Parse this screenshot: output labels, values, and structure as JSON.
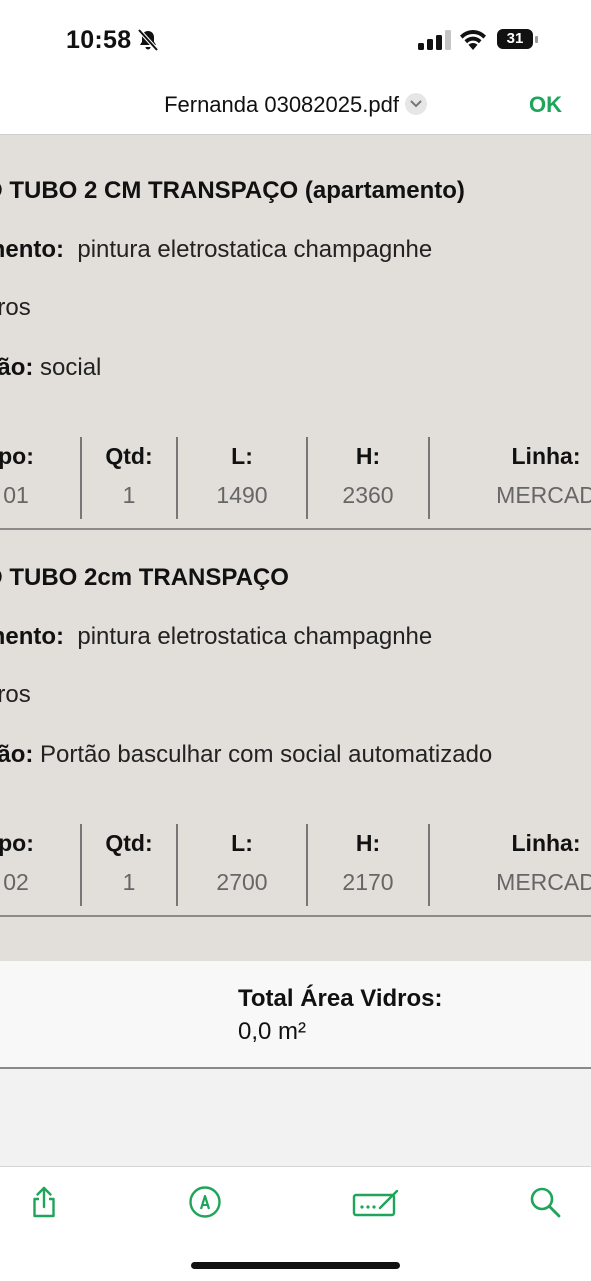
{
  "status": {
    "time": "10:58",
    "battery": "31"
  },
  "nav": {
    "title": "Fernanda 03082025.pdf",
    "ok_label": "OK"
  },
  "items": [
    {
      "title": "O TUBO 2 CM TRANSPAÇO (apartamento)",
      "acab_label": "mento:",
      "acab_value": "pintura eletrostatica champagnhe",
      "vidros_label": "dros",
      "obs_label": "ção:",
      "obs_value": "social",
      "table": {
        "headers": [
          "po:",
          "Qtd:",
          "L:",
          "H:",
          "Linha:"
        ],
        "values": [
          "01",
          "1",
          "1490",
          "2360",
          "MERCAD"
        ]
      }
    },
    {
      "title": "O TUBO 2cm TRANSPAÇO",
      "acab_label": "mento:",
      "acab_value": "pintura eletrostatica champagnhe",
      "vidros_label": "dros",
      "obs_label": "ção:",
      "obs_value": "Portão basculhar com social automatizado",
      "table": {
        "headers": [
          "po:",
          "Qtd:",
          "L:",
          "H:",
          "Linha:"
        ],
        "values": [
          "02",
          "1",
          "2700",
          "2170",
          "MERCAD"
        ]
      }
    }
  ],
  "totals": {
    "label": "Total Área Vidros:",
    "value": "0,0 m²"
  },
  "toolbar": {
    "icons": [
      "share-icon",
      "markup-icon",
      "signature-icon",
      "search-icon"
    ],
    "accent": "#1fa45a"
  }
}
